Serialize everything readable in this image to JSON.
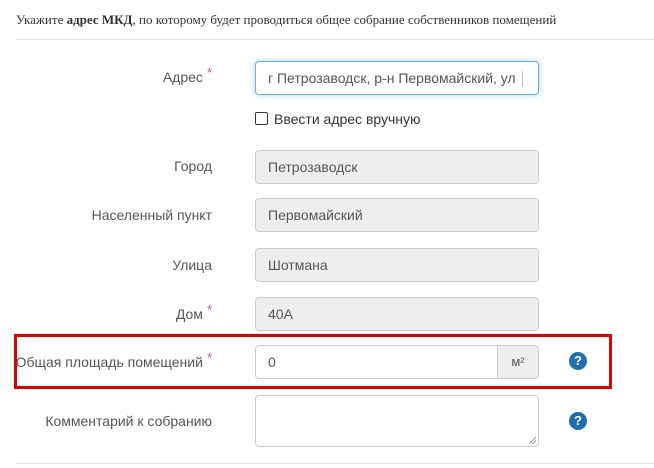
{
  "intro": {
    "prefix": "Укажите ",
    "bold": "адрес МКД",
    "suffix": ", по которому будет проводиться общее собрание собственников помещений"
  },
  "form": {
    "address": {
      "label": "Адрес",
      "required_mark": "*",
      "value": "г Петрозаводск, р-н Первомайский, ул"
    },
    "manual_checkbox": {
      "label": "Ввести адрес вручную",
      "checked": false
    },
    "city": {
      "label": "Город",
      "value": "Петрозаводск"
    },
    "settlement": {
      "label": "Населенный пункт",
      "value": "Первомайский"
    },
    "street": {
      "label": "Улица",
      "value": "Шотмана"
    },
    "house": {
      "label": "Дом",
      "required_mark": "*",
      "value": "40А"
    },
    "area": {
      "label": "Общая площадь помещений",
      "required_mark": "*",
      "value": "0",
      "unit": "м²",
      "help_icon": "?"
    },
    "comment": {
      "label": "Комментарий к собранию",
      "value": "",
      "help_icon": "?"
    }
  },
  "colors": {
    "required": "#d9534f",
    "highlight": "#e00000",
    "help": "#1f6fae",
    "readonly_bg": "#eeeeee"
  }
}
